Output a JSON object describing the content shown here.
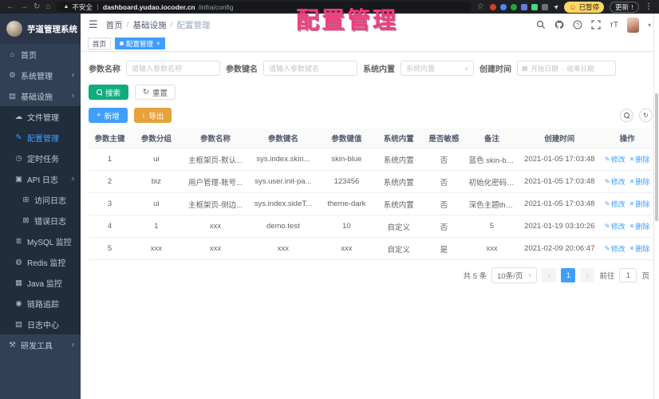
{
  "watermark": "配置管理",
  "icons": {
    "back": "←",
    "forward": "→",
    "reload": "↻",
    "home": "⌂",
    "warning": "▲",
    "star": "☆",
    "pin": "➤",
    "dots": "⋮",
    "smiley": "☺",
    "hamburger": "☰",
    "breadcrumb_sep": "/",
    "font_size": "тT",
    "caret_down": "▾",
    "chevron_down": "∨",
    "chevron_up": "∧",
    "calendar": "▦",
    "reset": "↻",
    "add": "+",
    "export": "↓",
    "refresh": "↻",
    "edit": "✎",
    "delete": "✕",
    "close": "×",
    "prev": "‹",
    "next": "›",
    "update_excl": "!"
  },
  "browser": {
    "security_warning": "不安全",
    "url_host": "dashboard.yudao.iocoder.cn",
    "url_path": "/infra/config",
    "paused_badge": "已暂停",
    "update_button": "更新",
    "extensions": [
      {
        "name": "extension-1-icon",
        "color": "#d93f21",
        "shape": "circle"
      },
      {
        "name": "extension-2-icon",
        "color": "#4b8bf5",
        "shape": "circle"
      },
      {
        "name": "extension-3-icon",
        "color": "#27a245",
        "shape": "circle"
      },
      {
        "name": "extension-4-icon",
        "color": "#5f7de0",
        "shape": "square"
      },
      {
        "name": "extension-5-icon",
        "color": "#3ddc84",
        "shape": "square"
      },
      {
        "name": "extension-6-icon",
        "color": "#6d7378",
        "shape": "square"
      }
    ]
  },
  "sidebar": {
    "app_title": "芋道管理系统",
    "items": [
      {
        "id": "home",
        "label": "首页",
        "icon": "home-icon",
        "glyph": "⌂",
        "depth": 0
      },
      {
        "id": "system",
        "label": "系统管理",
        "icon": "gear-icon",
        "glyph": "⚙",
        "depth": 0,
        "chevron": "down"
      },
      {
        "id": "infra",
        "label": "基础设施",
        "icon": "infra-icon",
        "glyph": "▤",
        "depth": 0,
        "chevron": "up"
      },
      {
        "id": "file",
        "label": "文件管理",
        "icon": "file-upload-icon",
        "glyph": "☁",
        "depth": 1,
        "sub": true
      },
      {
        "id": "config",
        "label": "配置管理",
        "icon": "edit-icon",
        "glyph": "✎",
        "depth": 1,
        "sub": true,
        "active": true
      },
      {
        "id": "job",
        "label": "定时任务",
        "icon": "clock-icon",
        "glyph": "◷",
        "depth": 1,
        "sub": true
      },
      {
        "id": "api-log",
        "label": "API 日志",
        "icon": "document-icon",
        "glyph": "▣",
        "depth": 1,
        "sub": true,
        "chevron": "up"
      },
      {
        "id": "access-log",
        "label": "访问日志",
        "icon": "document-icon",
        "glyph": "⊞",
        "depth": 2,
        "sub": true
      },
      {
        "id": "error-log",
        "label": "错误日志",
        "icon": "document-icon",
        "glyph": "⊠",
        "depth": 2,
        "sub": true
      },
      {
        "id": "mysql",
        "label": "MySQL 监控",
        "icon": "database-icon",
        "glyph": "≣",
        "depth": 1,
        "sub": true
      },
      {
        "id": "redis",
        "label": "Redis 监控",
        "icon": "database-icon",
        "glyph": "◍",
        "depth": 1,
        "sub": true
      },
      {
        "id": "java",
        "label": "Java 监控",
        "icon": "monitor-icon",
        "glyph": "▦",
        "depth": 1,
        "sub": true
      },
      {
        "id": "trace",
        "label": "链路追踪",
        "icon": "trace-icon",
        "glyph": "◉",
        "depth": 1,
        "sub": true
      },
      {
        "id": "log-center",
        "label": "日志中心",
        "icon": "log-icon",
        "glyph": "▤",
        "depth": 1,
        "sub": true
      },
      {
        "id": "dev-tools",
        "label": "研发工具",
        "icon": "tools-icon",
        "glyph": "⚒",
        "depth": 0,
        "chevron": "down"
      }
    ]
  },
  "header": {
    "breadcrumb": [
      "首页",
      "基础设施",
      "配置管理"
    ]
  },
  "tags": [
    {
      "label": "首页"
    },
    {
      "label": "配置管理"
    }
  ],
  "filters": {
    "name_label": "参数名称",
    "name_placeholder": "请输入参数名称",
    "key_label": "参数键名",
    "key_placeholder": "请输入参数键名",
    "type_label": "系统内置",
    "type_placeholder": "系统内置",
    "date_label": "创建时间",
    "date_start": "开始日期",
    "date_separator": "-",
    "date_end": "结束日期",
    "search_label": "搜索",
    "reset_label": "重置"
  },
  "toolbar": {
    "add_label": "新增",
    "export_label": "导出"
  },
  "table": {
    "headers": [
      "参数主键",
      "参数分组",
      "参数名称",
      "参数键名",
      "参数键值",
      "系统内置",
      "是否敏感",
      "备注",
      "创建时间",
      "操作"
    ],
    "rows": [
      {
        "cells": [
          "1",
          "ui",
          "主框架页-默认...",
          "sys.index.skin...",
          "skin-blue",
          "系统内置",
          "否",
          "蓝色 skin-blue...",
          "2021-01-05 17:03:48"
        ]
      },
      {
        "cells": [
          "2",
          "biz",
          "用户管理-账号...",
          "sys.user.init-pa...",
          "123456",
          "系统内置",
          "否",
          "初始化密码 123...",
          "2021-01-05 17:03:48"
        ]
      },
      {
        "cells": [
          "3",
          "ui",
          "主框架页-侧边...",
          "sys.index.sideT...",
          "theme-dark",
          "系统内置",
          "否",
          "深色主题theme...",
          "2021-01-05 17:03:48"
        ]
      },
      {
        "cells": [
          "4",
          "1",
          "xxx",
          "demo.test",
          "10",
          "自定义",
          "否",
          "5",
          "2021-01-19 03:10:26"
        ]
      },
      {
        "cells": [
          "5",
          "xxx",
          "xxx",
          "xxx",
          "xxx",
          "自定义",
          "是",
          "xxx",
          "2021-02-09 20:06:47"
        ]
      }
    ],
    "edit_label": "修改",
    "delete_label": "删除"
  },
  "pagination": {
    "total_text": "共 5 条",
    "page_size": "10条/页",
    "current_page": "1",
    "goto_label": "前往",
    "goto_value": "1",
    "goto_suffix": "页"
  }
}
